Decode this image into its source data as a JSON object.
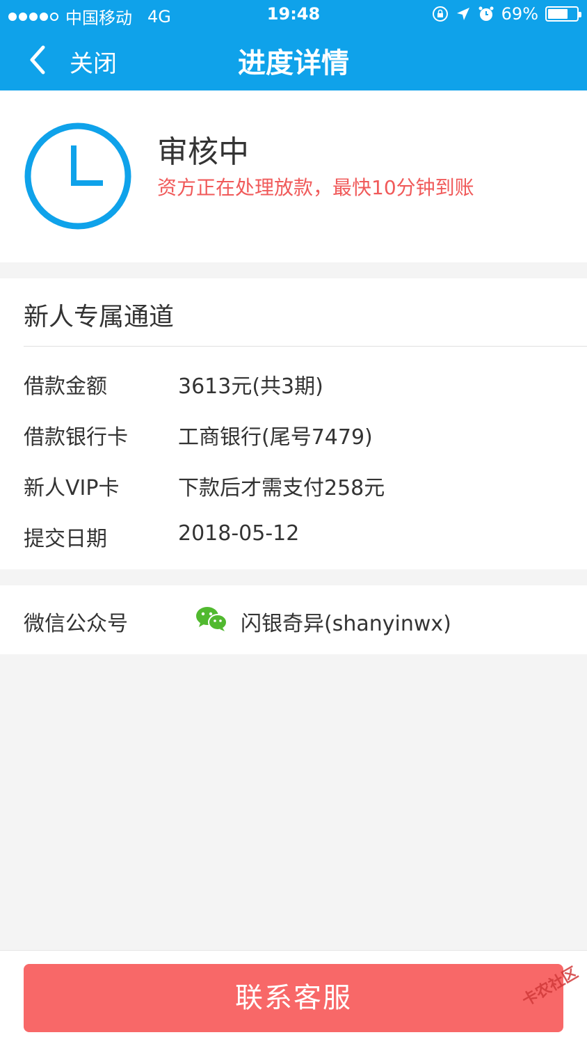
{
  "status_bar": {
    "carrier": "中国移动",
    "network": "4G",
    "time": "19:48",
    "battery": "69%",
    "battery_level": 0.69
  },
  "nav": {
    "close_label": "关闭",
    "title": "进度详情"
  },
  "status": {
    "title": "审核中",
    "description": "资方正在处理放款，最快10分钟到账",
    "accent_color": "#0fa2ea",
    "desc_color": "#f05a5a"
  },
  "loan": {
    "title": "新人专属通道",
    "rows": [
      {
        "label": "借款金额",
        "value": "3613元(共3期)"
      },
      {
        "label": "借款银行卡",
        "value": "工商银行(尾号7479)"
      },
      {
        "label": "新人VIP卡",
        "value": "下款后才需支付258元"
      },
      {
        "label": "提交日期",
        "value": "2018-05-12"
      }
    ]
  },
  "wechat": {
    "label": "微信公众号",
    "value": "闪银奇异(shanyinwx)",
    "icon": "wechat-icon"
  },
  "footer": {
    "contact_label": "联系客服",
    "button_color": "#f86868"
  },
  "watermark": "卡农社区"
}
